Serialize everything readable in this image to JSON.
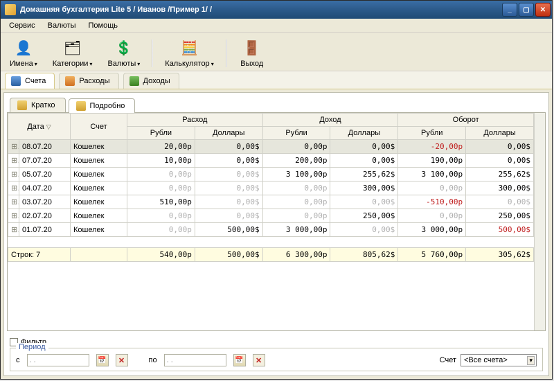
{
  "title": "Домашняя бухгалтерия Lite 5  / Иванов /Пример 1/ /",
  "menu": {
    "service": "Сервис",
    "currencies": "Валюты",
    "help": "Помощь"
  },
  "toolbar": {
    "names": {
      "label": "Имена",
      "icon": "👤"
    },
    "categories": {
      "label": "Категории",
      "icon": "🗂"
    },
    "currencies": {
      "label": "Валюты",
      "icon": "💲"
    },
    "calculator": {
      "label": "Калькулятор",
      "icon": "🧮"
    },
    "exit": {
      "label": "Выход",
      "icon": "🚪"
    }
  },
  "main_tabs": {
    "accounts": "Счета",
    "expenses": "Расходы",
    "income": "Доходы"
  },
  "view_tabs": {
    "brief": "Кратко",
    "detail": "Подробно"
  },
  "grid": {
    "hdr": {
      "date": "Дата",
      "account": "Счет",
      "expense": "Расход",
      "income": "Доход",
      "turnover": "Оборот",
      "rubles": "Рубли",
      "dollars": "Доллары"
    },
    "rows": [
      {
        "date": "08.07.20",
        "acct": "Кошелек",
        "exp_r": "20,00p",
        "exp_d": "0,00$",
        "inc_r": "0,00p",
        "inc_d": "0,00$",
        "tur_r": "-20,00p",
        "tur_d": "0,00$",
        "exp_r_light": false,
        "tur_r_neg": true
      },
      {
        "date": "07.07.20",
        "acct": "Кошелек",
        "exp_r": "10,00p",
        "exp_d": "0,00$",
        "inc_r": "200,00p",
        "inc_d": "0,00$",
        "tur_r": "190,00p",
        "tur_d": "0,00$",
        "exp_r_light": false
      },
      {
        "date": "05.07.20",
        "acct": "Кошелек",
        "exp_r": "0,00p",
        "exp_d": "0,00$",
        "inc_r": "3 100,00p",
        "inc_d": "255,62$",
        "tur_r": "3 100,00p",
        "tur_d": "255,62$",
        "exp_r_light": true,
        "exp_d_light": true
      },
      {
        "date": "04.07.20",
        "acct": "Кошелек",
        "exp_r": "0,00p",
        "exp_d": "0,00$",
        "inc_r": "0,00p",
        "inc_d": "300,00$",
        "tur_r": "0,00p",
        "tur_d": "300,00$",
        "exp_r_light": true,
        "exp_d_light": true,
        "inc_r_light": true,
        "tur_r_light": true
      },
      {
        "date": "03.07.20",
        "acct": "Кошелек",
        "exp_r": "510,00p",
        "exp_d": "0,00$",
        "inc_r": "0,00p",
        "inc_d": "0,00$",
        "tur_r": "-510,00p",
        "tur_d": "0,00$",
        "tur_r_neg": true,
        "inc_r_light": true,
        "inc_d_light": true,
        "exp_d_light": true,
        "tur_d_light": true
      },
      {
        "date": "02.07.20",
        "acct": "Кошелек",
        "exp_r": "0,00p",
        "exp_d": "0,00$",
        "inc_r": "0,00p",
        "inc_d": "250,00$",
        "tur_r": "0,00p",
        "tur_d": "250,00$",
        "exp_r_light": true,
        "exp_d_light": true,
        "inc_r_light": true,
        "tur_r_light": true
      },
      {
        "date": "01.07.20",
        "acct": "Кошелек",
        "exp_r": "0,00p",
        "exp_d": "500,00$",
        "inc_r": "3 000,00p",
        "inc_d": "0,00$",
        "tur_r": "3 000,00p",
        "tur_d": "500,00$",
        "exp_r_light": true,
        "inc_d_light": true,
        "tur_d_neg": true
      }
    ],
    "footer": {
      "rowcount": "Строк: 7",
      "exp_r": "540,00p",
      "exp_d": "500,00$",
      "inc_r": "6 300,00p",
      "inc_d": "805,62$",
      "tur_r": "5 760,00p",
      "tur_d": "305,62$"
    }
  },
  "filter": {
    "label": "Фильтр",
    "period": "Период",
    "from": "с",
    "to": "по",
    "date_placeholder": " .  .   ",
    "account_label": "Счет",
    "account_value": "<Все счета>"
  }
}
